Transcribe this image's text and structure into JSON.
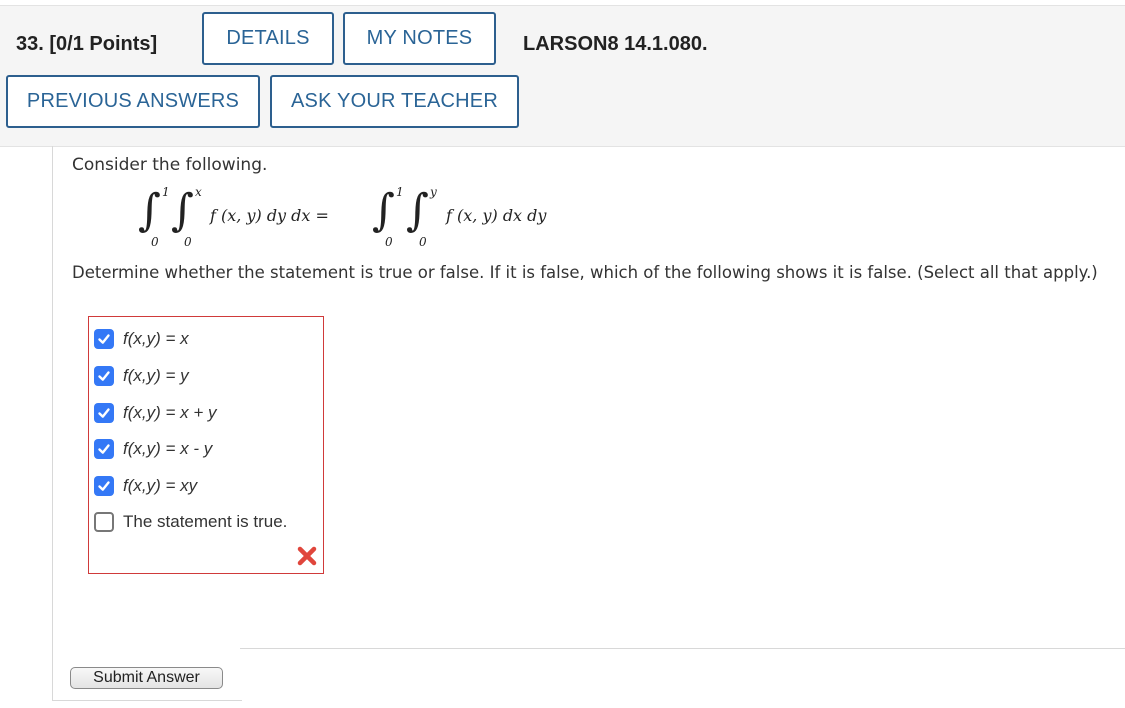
{
  "header": {
    "question_number": "33.",
    "points": "[0/1 Points]",
    "details_label": "DETAILS",
    "my_notes_label": "MY NOTES",
    "question_code": "LARSON8 14.1.080.",
    "previous_answers_label": "PREVIOUS ANSWERS",
    "ask_teacher_label": "ASK YOUR TEACHER"
  },
  "question": {
    "prompt": "Consider the following.",
    "equation": {
      "left": {
        "outer_upper": "1",
        "outer_lower": "0",
        "inner_upper": "x",
        "inner_lower": "0",
        "integrand": "f (x, y)  dy  dx ="
      },
      "right": {
        "outer_upper": "1",
        "outer_lower": "0",
        "inner_upper": "y",
        "inner_lower": "0",
        "integrand": "f (x, y)  dx  dy"
      }
    },
    "instruction": "Determine whether the statement is true or false. If it is false, which of the following shows it is false. (Select all that apply.)"
  },
  "options": [
    {
      "label": "f(x,y) = x",
      "checked": true
    },
    {
      "label": "f(x,y) = y",
      "checked": true
    },
    {
      "label": "f(x,y) = x + y",
      "checked": true
    },
    {
      "label": "f(x,y) = x - y",
      "checked": true
    },
    {
      "label": "f(x,y) = xy",
      "checked": true
    },
    {
      "label": "The statement is true.",
      "checked": false
    }
  ],
  "result": {
    "icon": "incorrect-x-icon",
    "color": "#e0463c"
  },
  "colors": {
    "button_border": "#2d5f8e",
    "button_text": "#2a6496",
    "checkbox_checked": "#3478f6",
    "answer_border": "#d03a3a"
  },
  "submit_label": "Submit Answer"
}
